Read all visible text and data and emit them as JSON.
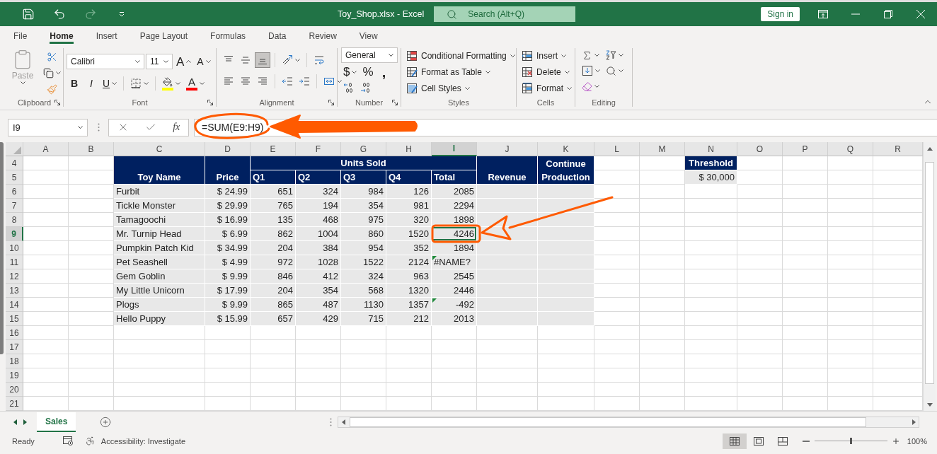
{
  "window": {
    "title": "Toy_Shop.xlsx - Excel",
    "search": {
      "placeholder": "Search (Alt+Q)"
    },
    "sign_in": "Sign in",
    "quick_access": [
      {
        "kind": "save",
        "disabled": false
      },
      {
        "kind": "undo",
        "disabled": false
      },
      {
        "kind": "redo",
        "disabled": true
      },
      {
        "kind": "customize",
        "disabled": false
      }
    ]
  },
  "ribbon_tabs": [
    {
      "label": "File",
      "selected": false
    },
    {
      "label": "Home",
      "selected": true
    },
    {
      "label": "Insert",
      "selected": false
    },
    {
      "label": "Page Layout",
      "selected": false
    },
    {
      "label": "Formulas",
      "selected": false
    },
    {
      "label": "Data",
      "selected": false
    },
    {
      "label": "Review",
      "selected": false
    },
    {
      "label": "View",
      "selected": false
    }
  ],
  "ribbon": {
    "clipboard": {
      "label": "Clipboard",
      "paste": {
        "label": "Paste",
        "disabled": true
      }
    },
    "font": {
      "label": "Font",
      "font_name": "Calibri",
      "font_size": "11",
      "grow": "A",
      "shrink": "A",
      "bold": "B",
      "italic": "I",
      "underline": "U",
      "fill_color": {
        "color": "#ffff00"
      },
      "font_color": {
        "label": "A",
        "color": "#ff0000"
      }
    },
    "alignment": {
      "label": "Alignment",
      "vertical": [
        {
          "kind": "top",
          "selected": false
        },
        {
          "kind": "middle",
          "selected": false
        },
        {
          "kind": "bottom",
          "selected": true
        }
      ],
      "horizontal": [
        {
          "kind": "left",
          "selected": false
        },
        {
          "kind": "center",
          "selected": false
        },
        {
          "kind": "right",
          "selected": false
        }
      ]
    },
    "number": {
      "label": "Number",
      "format": "General",
      "currency": "$",
      "percent": "%",
      "comma": ","
    },
    "styles": {
      "label": "Styles",
      "items": [
        {
          "kind": "conditional",
          "label": "Conditional Formatting"
        },
        {
          "kind": "table",
          "label": "Format as Table"
        },
        {
          "kind": "cell",
          "label": "Cell Styles"
        }
      ]
    },
    "cells": {
      "label": "Cells",
      "items": [
        {
          "kind": "insert",
          "label": "Insert"
        },
        {
          "kind": "delete",
          "label": "Delete"
        },
        {
          "kind": "format",
          "label": "Format"
        }
      ]
    },
    "editing": {
      "label": "Editing"
    }
  },
  "formula_bar": {
    "name_box": "I9",
    "function_button": "fx",
    "formula": "=SUM(E9:H9)"
  },
  "sheet": {
    "columns": [
      {
        "label": "A",
        "selected": false
      },
      {
        "label": "B",
        "selected": false
      },
      {
        "label": "C",
        "selected": false
      },
      {
        "label": "D",
        "selected": false
      },
      {
        "label": "E",
        "selected": false
      },
      {
        "label": "F",
        "selected": false
      },
      {
        "label": "G",
        "selected": false
      },
      {
        "label": "H",
        "selected": false
      },
      {
        "label": "I",
        "selected": true
      },
      {
        "label": "J",
        "selected": false
      },
      {
        "label": "K",
        "selected": false
      },
      {
        "label": "L",
        "selected": false
      },
      {
        "label": "M",
        "selected": false
      },
      {
        "label": "N",
        "selected": false
      },
      {
        "label": "O",
        "selected": false
      },
      {
        "label": "P",
        "selected": false
      },
      {
        "label": "Q",
        "selected": false
      },
      {
        "label": "R",
        "selected": false
      }
    ],
    "rows": [
      {
        "label": "4",
        "selected": false
      },
      {
        "label": "5",
        "selected": false
      },
      {
        "label": "6",
        "selected": false
      },
      {
        "label": "7",
        "selected": false
      },
      {
        "label": "8",
        "selected": false
      },
      {
        "label": "9",
        "selected": true
      },
      {
        "label": "10",
        "selected": false
      },
      {
        "label": "11",
        "selected": false
      },
      {
        "label": "12",
        "selected": false
      },
      {
        "label": "13",
        "selected": false
      },
      {
        "label": "14",
        "selected": false
      },
      {
        "label": "15",
        "selected": false
      },
      {
        "label": "16",
        "selected": false
      },
      {
        "label": "17",
        "selected": false
      },
      {
        "label": "18",
        "selected": false
      },
      {
        "label": "19",
        "selected": false
      },
      {
        "label": "20",
        "selected": false
      },
      {
        "label": "21",
        "selected": false
      }
    ],
    "table": {
      "header": {
        "toy_name": "Toy Name",
        "price": "Price",
        "units_sold": "Units Sold",
        "quarters": [
          "Q1",
          "Q2",
          "Q3",
          "Q4"
        ],
        "total": "Total",
        "revenue": "Revenue",
        "continue_production": "Continue Production"
      },
      "rows": [
        {
          "toy": "Furbit",
          "price": "$ 24.99",
          "units": [
            "651",
            "324",
            "984",
            "126"
          ],
          "total": {
            "text": "2085",
            "kind": "number",
            "flagged": false,
            "selected": false
          }
        },
        {
          "toy": "Tickle Monster",
          "price": "$ 29.99",
          "units": [
            "765",
            "194",
            "354",
            "981"
          ],
          "total": {
            "text": "2294",
            "kind": "number",
            "flagged": false,
            "selected": false
          }
        },
        {
          "toy": "Tamagoochi",
          "price": "$ 16.99",
          "units": [
            "135",
            "468",
            "975",
            "320"
          ],
          "total": {
            "text": "1898",
            "kind": "number",
            "flagged": false,
            "selected": false
          }
        },
        {
          "toy": "Mr. Turnip Head",
          "price": "$ 6.99",
          "units": [
            "862",
            "1004",
            "860",
            "1520"
          ],
          "total": {
            "text": "4246",
            "kind": "number",
            "flagged": false,
            "selected": true
          }
        },
        {
          "toy": "Pumpkin Patch Kid",
          "price": "$ 34.99",
          "units": [
            "204",
            "384",
            "954",
            "352"
          ],
          "total": {
            "text": "1894",
            "kind": "number",
            "flagged": false,
            "selected": false
          }
        },
        {
          "toy": "Pet Seashell",
          "price": "$ 4.99",
          "units": [
            "972",
            "1028",
            "1522",
            "2124"
          ],
          "total": {
            "text": "#NAME?",
            "kind": "error",
            "flagged": true,
            "selected": false
          }
        },
        {
          "toy": "Gem Goblin",
          "price": "$ 9.99",
          "units": [
            "846",
            "412",
            "324",
            "963"
          ],
          "total": {
            "text": "2545",
            "kind": "number",
            "flagged": false,
            "selected": false
          }
        },
        {
          "toy": "My Little Unicorn",
          "price": "$ 17.99",
          "units": [
            "204",
            "354",
            "568",
            "1320"
          ],
          "total": {
            "text": "2446",
            "kind": "number",
            "flagged": false,
            "selected": false
          }
        },
        {
          "toy": "Plogs",
          "price": "$ 9.99",
          "units": [
            "865",
            "487",
            "1130",
            "1357"
          ],
          "total": {
            "text": "-492",
            "kind": "number",
            "flagged": true,
            "selected": false
          }
        },
        {
          "toy": "Hello Puppy",
          "price": "$ 15.99",
          "units": [
            "657",
            "429",
            "715",
            "212"
          ],
          "total": {
            "text": "2013",
            "kind": "number",
            "flagged": false,
            "selected": false
          }
        }
      ]
    },
    "threshold": {
      "label": "Threshold",
      "value": "$ 30,000"
    }
  },
  "sheet_tabs": [
    {
      "label": "Sales",
      "selected": true
    }
  ],
  "status_bar": {
    "status": "Ready",
    "accessibility": "Accessibility: Investigate",
    "views": [
      {
        "kind": "normal",
        "selected": true
      },
      {
        "kind": "page_layout",
        "selected": false
      },
      {
        "kind": "page_break",
        "selected": false
      }
    ],
    "zoom": {
      "level": 0.5,
      "reading": "100%"
    }
  }
}
